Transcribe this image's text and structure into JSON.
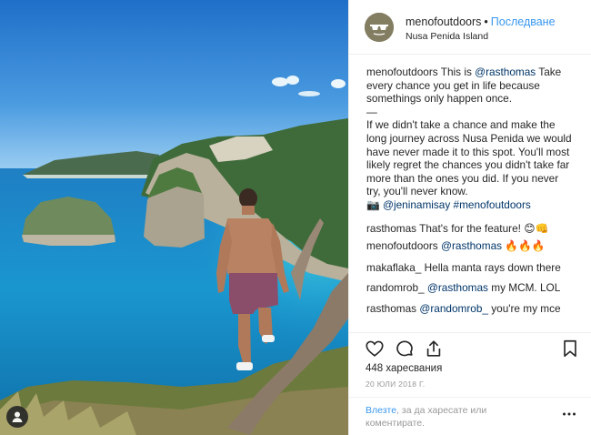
{
  "post": {
    "username": "menofoutdoors",
    "separator": "•",
    "follow_label": "Последване",
    "location": "Nusa Penida Island"
  },
  "caption": {
    "author": "menofoutdoors",
    "line1_pre": "This is",
    "line1_mention": "@rasthomas",
    "line1_post": "Take",
    "line2": "every chance you get in life because",
    "line3": "somethings only happen once.",
    "dash": "—",
    "body_lines": [
      "If we didn't take a chance and make the",
      "long journey across Nusa Penida we would",
      "have never made it to this spot. You'll most",
      "likely regret the chances you didn't take far",
      "more than the ones you did. If you never",
      "try, you'll never know."
    ],
    "camera_emoji": "📷",
    "credit_mention": "@jeninamisay",
    "hashtag": "#menofoutdoors"
  },
  "comments": [
    {
      "user": "rasthomas",
      "pre": "That's for the feature!",
      "mention": "",
      "post": "",
      "emoji": "😊👊"
    },
    {
      "user": "menofoutdoors",
      "pre": "",
      "mention": "@rasthomas",
      "post": "",
      "emoji": "🔥🔥🔥"
    },
    {
      "user": "makaflaka_",
      "pre": "Hella manta rays down there",
      "mention": "",
      "post": "",
      "emoji": ""
    },
    {
      "user": "randomrob_",
      "pre": "",
      "mention": "@rasthomas",
      "post": "my MCM. LOL",
      "emoji": ""
    },
    {
      "user": "rasthomas",
      "pre": "",
      "mention": "@randomrob_",
      "post": "you're my mce",
      "emoji": ""
    }
  ],
  "actions": {
    "icons": [
      "heart-icon",
      "comment-icon",
      "share-icon",
      "bookmark-icon"
    ]
  },
  "likes_label": "448 харесвания",
  "date_label": "20 ЮЛИ 2018 Г.",
  "login": {
    "link_text": "Влезте",
    "rest_text": ", за да харесате или коментирате."
  },
  "colors": {
    "link_blue": "#3897f0",
    "mention_blue": "#003569",
    "muted": "#999999",
    "divider": "#efefef"
  }
}
